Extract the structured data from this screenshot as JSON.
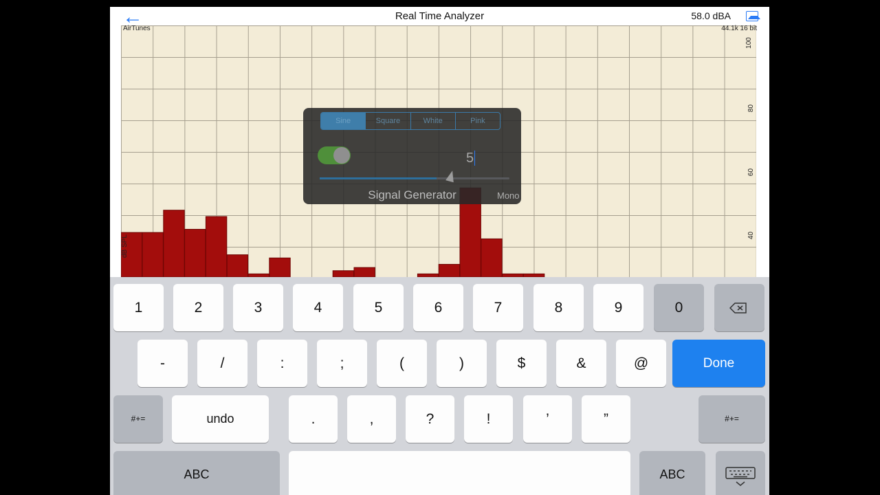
{
  "app": {
    "title": "Real Time Analyzer",
    "level": "58.0 dBA",
    "source": "AirTunes",
    "format": "44.1k 16 bit",
    "back_icon": "back-arrow-icon",
    "image_icon": "picture-icon"
  },
  "chart_data": {
    "type": "bar",
    "ylabel": "dB SPL",
    "yticks": [
      "100",
      "80",
      "60",
      "40"
    ],
    "ylim": [
      33,
      112
    ],
    "values": [
      47,
      47,
      54,
      48,
      52,
      40,
      34,
      39,
      33,
      33,
      35,
      36,
      33,
      33,
      34,
      37,
      61,
      45,
      34,
      34
    ],
    "bar_color": "#a30d0c",
    "grid": true,
    "background": "#f3ecd7"
  },
  "signal_generator": {
    "tabs": [
      "Sine",
      "Square",
      "White",
      "Pink"
    ],
    "active_tab": "Sine",
    "enabled": true,
    "input_value": "5",
    "slider_fraction": 0.64,
    "label": "Signal Generator",
    "mode_label": "Mono"
  },
  "keyboard": {
    "row1": [
      "1",
      "2",
      "3",
      "4",
      "5",
      "6",
      "7",
      "8",
      "9",
      "0"
    ],
    "row2": [
      "-",
      "/",
      ":",
      ";",
      "(",
      ")",
      "$",
      "&",
      "@"
    ],
    "done_label": "Done",
    "row3": [
      "undo",
      ".",
      ",",
      "?",
      "!",
      "’",
      "”"
    ],
    "symbols_label": "#+=",
    "abc_label": "ABC",
    "backspace_icon": "backspace-icon",
    "dismiss_icon": "keyboard-dismiss-icon"
  }
}
